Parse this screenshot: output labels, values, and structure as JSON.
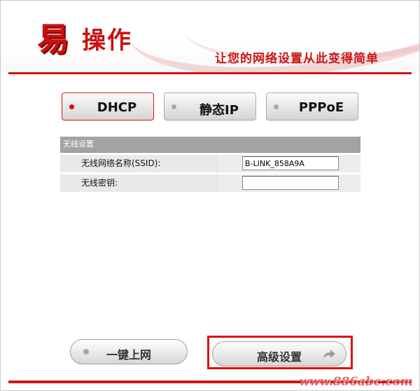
{
  "header": {
    "logo_char": "易",
    "logo_rest": "操作",
    "slogan": "让您的网络设置从此变得简单"
  },
  "modes": [
    {
      "label": "DHCP",
      "active": true
    },
    {
      "label": "静态IP",
      "active": false
    },
    {
      "label": "PPPoE",
      "active": false
    }
  ],
  "wireless": {
    "section_title": "无线设置",
    "ssid_label": "无线网络名称(SSID):",
    "ssid_value": "B-LINK_858A9A",
    "password_label": "无线密钥:",
    "password_value": ""
  },
  "buttons": {
    "onekey": "一键上网",
    "advanced": "高级设置"
  },
  "watermark": "www.886abc.com",
  "colors": {
    "accent": "#d41414",
    "section_header": "#a3a3a3"
  }
}
